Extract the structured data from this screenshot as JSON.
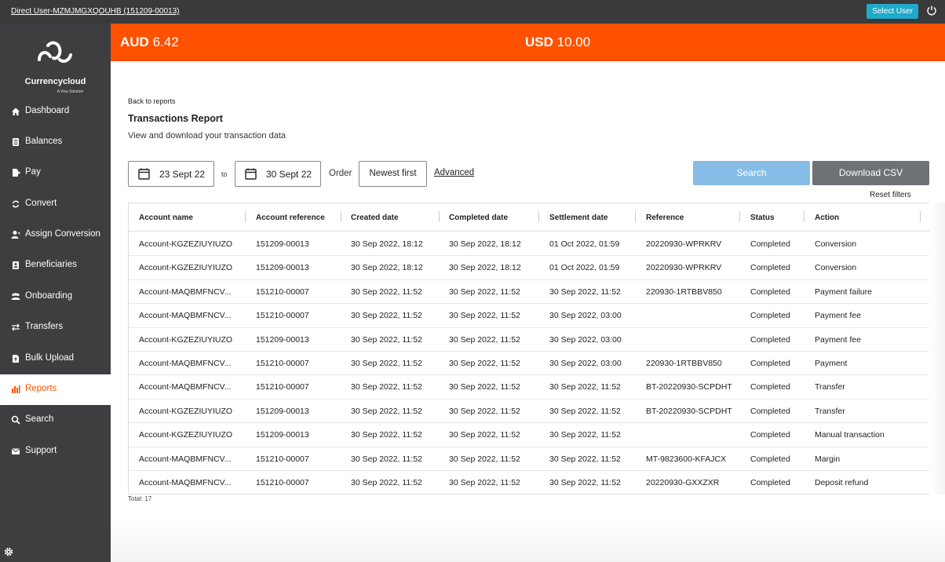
{
  "topbar": {
    "user_link": "Direct User-MZMJMGXQOUHB (151209-00013)",
    "select_user": "Select User",
    "power_icon": "power-icon"
  },
  "brand": {
    "name": "Currencycloud",
    "tagline": "A Visa Solution"
  },
  "sidebar": {
    "items": [
      {
        "label": "Dashboard",
        "icon": "home-icon"
      },
      {
        "label": "Balances",
        "icon": "balances-icon"
      },
      {
        "label": "Pay",
        "icon": "pay-icon"
      },
      {
        "label": "Convert",
        "icon": "convert-icon"
      },
      {
        "label": "Assign Conversion",
        "icon": "user-icon"
      },
      {
        "label": "Beneficiaries",
        "icon": "contact-card-icon"
      },
      {
        "label": "Onboarding",
        "icon": "users-icon"
      },
      {
        "label": "Transfers",
        "icon": "transfer-arrows-icon"
      },
      {
        "label": "Bulk Upload",
        "icon": "file-upload-icon"
      },
      {
        "label": "Reports",
        "icon": "reports-icon",
        "active": true
      },
      {
        "label": "Search",
        "icon": "search-icon"
      },
      {
        "label": "Support",
        "icon": "envelope-icon"
      }
    ],
    "settings_icon": "gear-icon"
  },
  "rates": {
    "aud_code": "AUD",
    "aud_value": "6.42",
    "usd_code": "USD",
    "usd_value": "10.00"
  },
  "page": {
    "back_link": "Back to reports",
    "title": "Transactions Report",
    "subtitle": "View and download your transaction data"
  },
  "filters": {
    "from_date": "23 Sept 22",
    "to_label": "to",
    "to_date": "30 Sept 22",
    "order_label": "Order",
    "order_value": "Newest first",
    "advanced": "Advanced",
    "search": "Search",
    "download_csv": "Download CSV",
    "reset": "Reset filters"
  },
  "table": {
    "headers": [
      "Account name",
      "Account reference",
      "Created date",
      "Completed date",
      "Settlement date",
      "Reference",
      "Status",
      "Action"
    ],
    "rows": [
      [
        "Account-KGZEZIUYIUZO",
        "151209-00013",
        "30 Sep 2022, 18:12",
        "30 Sep 2022, 18:12",
        "01 Oct 2022, 01:59",
        "20220930-WPRKRV",
        "Completed",
        "Conversion"
      ],
      [
        "Account-KGZEZIUYIUZO",
        "151209-00013",
        "30 Sep 2022, 18:12",
        "30 Sep 2022, 18:12",
        "01 Oct 2022, 01:59",
        "20220930-WPRKRV",
        "Completed",
        "Conversion"
      ],
      [
        "Account-MAQBMFNCV...",
        "151210-00007",
        "30 Sep 2022, 11:52",
        "30 Sep 2022, 11:52",
        "30 Sep 2022, 11:52",
        "220930-1RTBBV850",
        "Completed",
        "Payment failure"
      ],
      [
        "Account-MAQBMFNCV...",
        "151210-00007",
        "30 Sep 2022, 11:52",
        "30 Sep 2022, 11:52",
        "30 Sep 2022, 03:00",
        "",
        "Completed",
        "Payment fee"
      ],
      [
        "Account-KGZEZIUYIUZO",
        "151209-00013",
        "30 Sep 2022, 11:52",
        "30 Sep 2022, 11:52",
        "30 Sep 2022, 03:00",
        "",
        "Completed",
        "Payment fee"
      ],
      [
        "Account-MAQBMFNCV...",
        "151210-00007",
        "30 Sep 2022, 11:52",
        "30 Sep 2022, 11:52",
        "30 Sep 2022, 03:00",
        "220930-1RTBBV850",
        "Completed",
        "Payment"
      ],
      [
        "Account-MAQBMFNCV...",
        "151210-00007",
        "30 Sep 2022, 11:52",
        "30 Sep 2022, 11:52",
        "30 Sep 2022, 11:52",
        "BT-20220930-SCPDHT",
        "Completed",
        "Transfer"
      ],
      [
        "Account-KGZEZIUYIUZO",
        "151209-00013",
        "30 Sep 2022, 11:52",
        "30 Sep 2022, 11:52",
        "30 Sep 2022, 11:52",
        "BT-20220930-SCPDHT",
        "Completed",
        "Transfer"
      ],
      [
        "Account-KGZEZIUYIUZO",
        "151209-00013",
        "30 Sep 2022, 11:52",
        "30 Sep 2022, 11:52",
        "30 Sep 2022, 11:52",
        "",
        "Completed",
        "Manual transaction"
      ],
      [
        "Account-MAQBMFNCV...",
        "151210-00007",
        "30 Sep 2022, 11:52",
        "30 Sep 2022, 11:52",
        "30 Sep 2022, 11:52",
        "MT-9823600-KFAJCX",
        "Completed",
        "Margin"
      ],
      [
        "Account-MAQBMFNCV...",
        "151210-00007",
        "30 Sep 2022, 11:52",
        "30 Sep 2022, 11:52",
        "30 Sep 2022, 11:52",
        "20220930-GXXZXR",
        "Completed",
        "Deposit refund"
      ]
    ],
    "total": "Total: 17"
  },
  "colors": {
    "brand_orange": "#ff5100",
    "sidebar_bg": "#3d3e40",
    "topbar_bg": "#3a3a3a",
    "search_button": "#86bde6",
    "csv_button": "#6e7276",
    "select_user": "#20a9c9"
  }
}
